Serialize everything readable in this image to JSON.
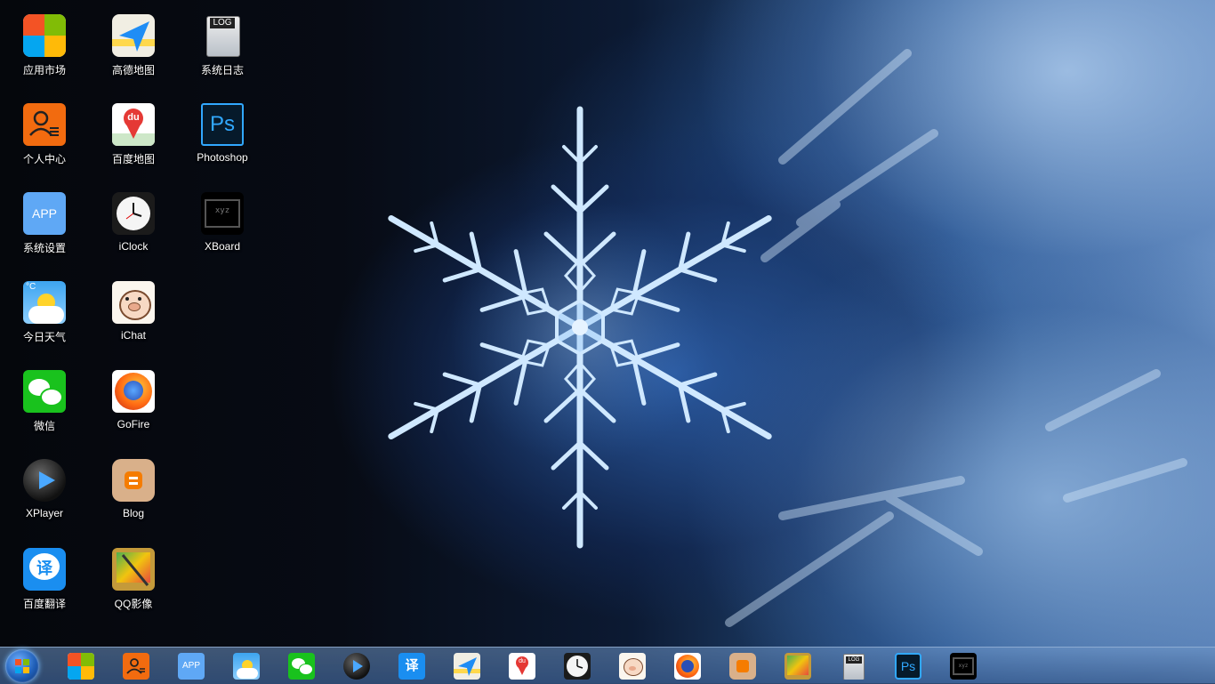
{
  "desktop": {
    "icons": [
      {
        "label": "应用市场",
        "icon": "windows-icon"
      },
      {
        "label": "个人中心",
        "icon": "user-center-icon"
      },
      {
        "label": "系统设置",
        "icon": "app-settings-icon"
      },
      {
        "label": "今日天气",
        "icon": "weather-icon"
      },
      {
        "label": "微信",
        "icon": "wechat-icon"
      },
      {
        "label": "XPlayer",
        "icon": "player-icon"
      },
      {
        "label": "百度翻译",
        "icon": "translate-icon"
      },
      {
        "label": "高德地图",
        "icon": "amap-icon"
      },
      {
        "label": "百度地图",
        "icon": "baidu-map-icon"
      },
      {
        "label": "iClock",
        "icon": "clock-icon"
      },
      {
        "label": "iChat",
        "icon": "pig-icon"
      },
      {
        "label": "GoFire",
        "icon": "firefox-icon"
      },
      {
        "label": "Blog",
        "icon": "blogger-icon"
      },
      {
        "label": "QQ影像",
        "icon": "photo-editor-icon"
      },
      {
        "label": "系统日志",
        "icon": "log-icon"
      },
      {
        "label": "Photoshop",
        "icon": "photoshop-icon"
      },
      {
        "label": "XBoard",
        "icon": "xboard-icon"
      }
    ],
    "badge_text": {
      "app": "APP",
      "weather_unit": "°C",
      "baidu": "du",
      "translate": "译",
      "log": "LOG",
      "ps": "Ps",
      "xboard": "xyz"
    }
  },
  "taskbar": {
    "start_icon": "windows-start-orb-icon",
    "items": [
      "应用市场",
      "个人中心",
      "系统设置",
      "今日天气",
      "微信",
      "XPlayer",
      "百度翻译",
      "高德地图",
      "百度地图",
      "iClock",
      "iChat",
      "GoFire",
      "Blog",
      "QQ影像",
      "系统日志",
      "Photoshop",
      "XBoard"
    ]
  },
  "colors": {
    "wallpaper_accent": "#2b5a94",
    "taskbar": "#4a78b0",
    "label_text": "#ffffff"
  }
}
